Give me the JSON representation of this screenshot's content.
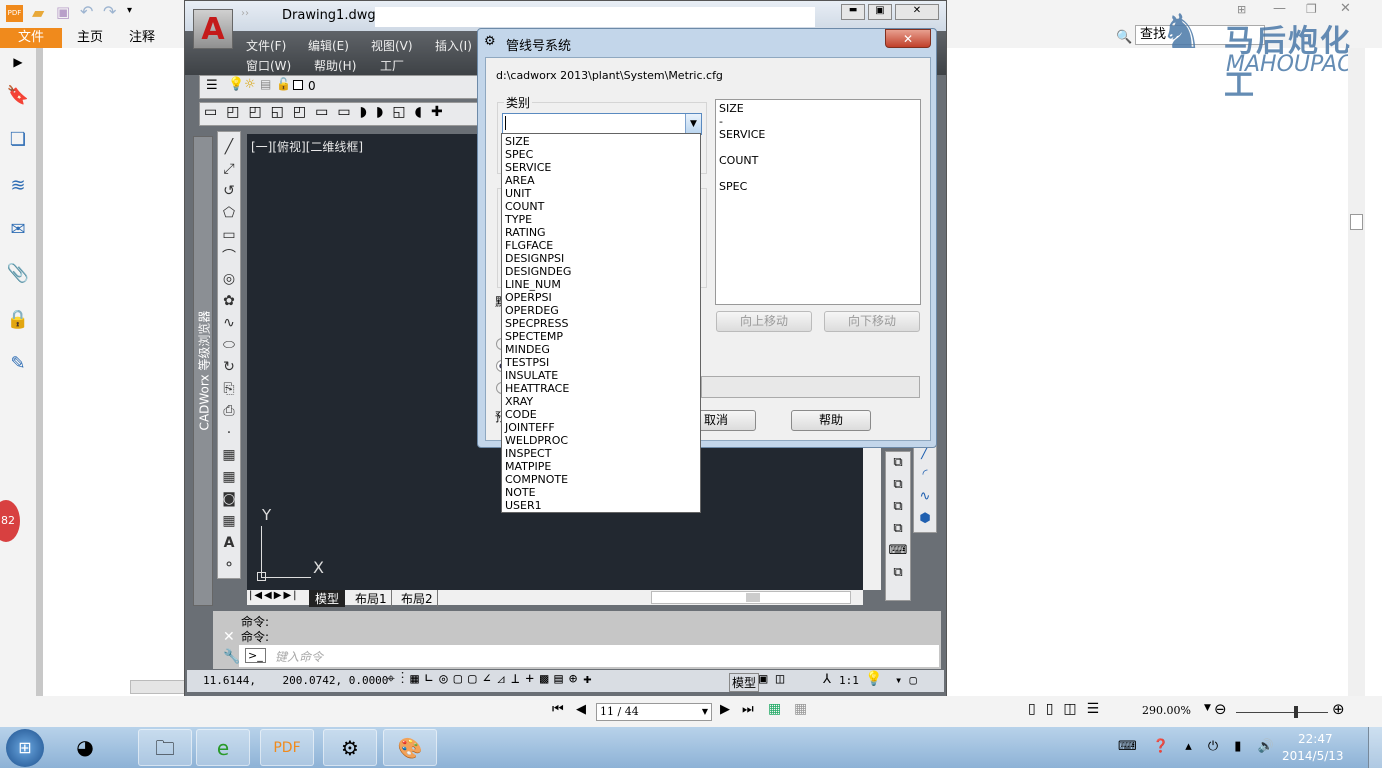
{
  "pdf": {
    "ribbon_tabs": [
      "文件",
      "主页",
      "注释"
    ],
    "search_placeholder": "查找",
    "watermark": "马后炮化工 MAHOUPAO",
    "badge": "82",
    "page_input": "11 / 44",
    "zoom": "290.00%",
    "accent": "#f08a1c"
  },
  "cad": {
    "title": "Drawing1.dwg",
    "menu": [
      "文件(F)",
      "编辑(E)",
      "视图(V)",
      "插入(I)",
      "窗口(W)",
      "帮助(H)",
      "工厂"
    ],
    "layer": "0",
    "viewport_label": "[一][俯视][二维线框]",
    "vertical_tab": "CADWorx 等级浏览器",
    "layout_tabs": [
      "模型",
      "布局1",
      "布局2"
    ],
    "command_history": [
      "命令:",
      "命令:"
    ],
    "command_placeholder": "键入命令",
    "coords": "11.6144,    200.0742, 0.0000",
    "status_model": "模型",
    "scale": "1:1",
    "axis_y": "Y",
    "axis_x": "X"
  },
  "dialog": {
    "title": "管线号系统",
    "path": "d:\\cadworx 2013\\plant\\System\\Metric.cfg",
    "category_label": "类别",
    "category_value": "",
    "options": [
      "SIZE",
      "SPEC",
      "SERVICE",
      "AREA",
      "UNIT",
      "COUNT",
      "TYPE",
      "RATING",
      "FLGFACE",
      "DESIGNPSI",
      "DESIGNDEG",
      "LINE_NUM",
      "OPERPSI",
      "OPERDEG",
      "SPECPRESS",
      "SPECTEMP",
      "MINDEG",
      "TESTPSI",
      "INSULATE",
      "HEATTRACE",
      "XRAY",
      "CODE",
      "JOINTEFF",
      "WELDPROC",
      "INSPECT",
      "MATPIPE",
      "COMPNOTE",
      "NOTE",
      "USER1"
    ],
    "selected_items": [
      "SIZE",
      "-",
      "SERVICE",
      "",
      "COUNT",
      "",
      "SPEC"
    ],
    "move_up": "向上移动",
    "move_down": "向下移动",
    "cancel": "取消",
    "help": "帮助",
    "partial_labels": [
      "默",
      "预"
    ]
  },
  "taskbar": {
    "time": "22:47",
    "date": "2014/5/13"
  }
}
